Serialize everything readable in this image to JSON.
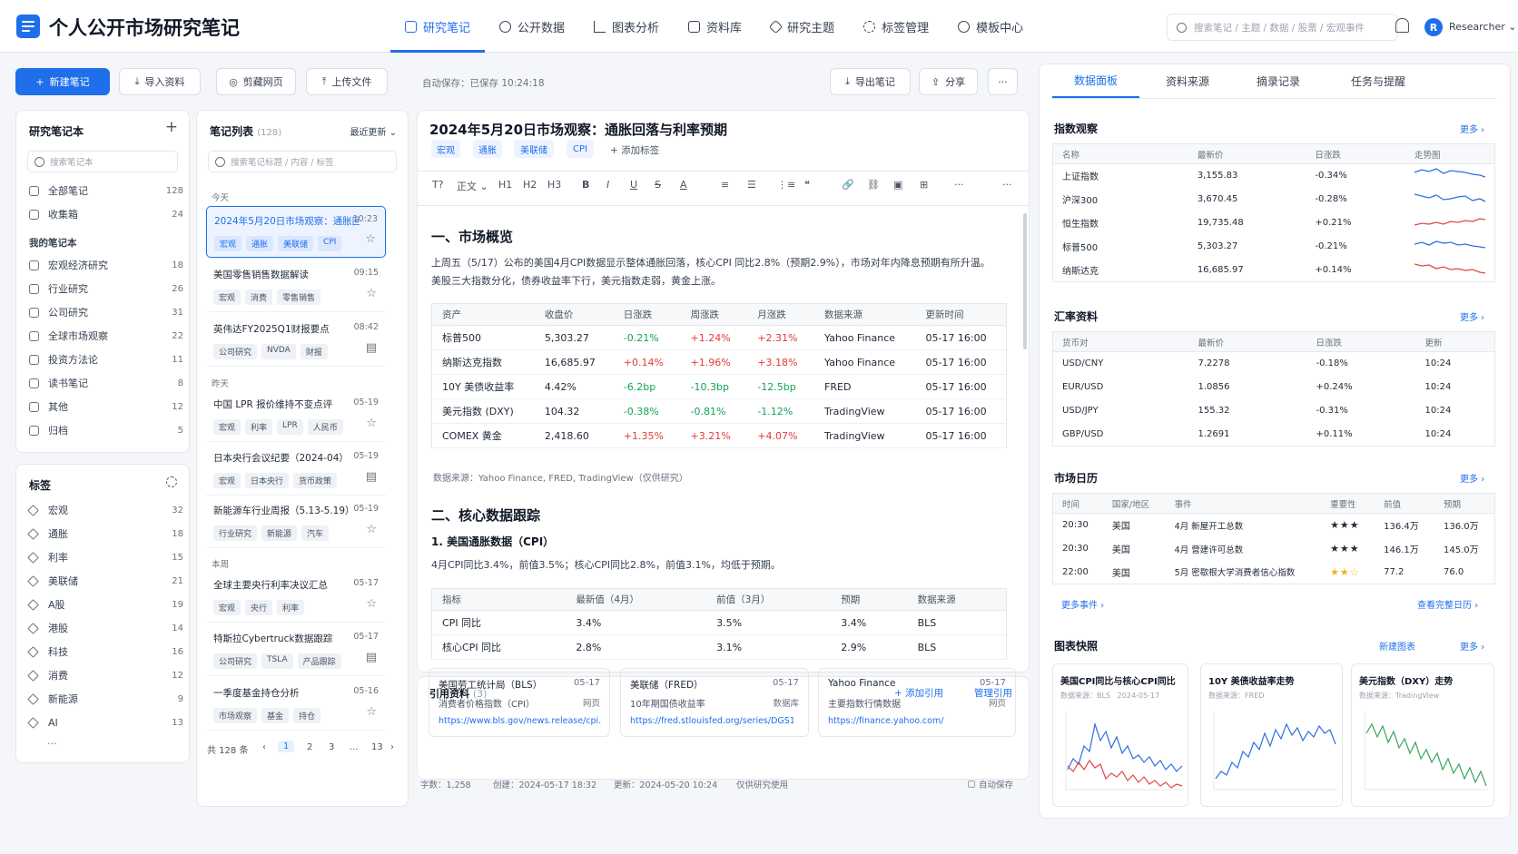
{
  "app": {
    "title": "个人公开市场研究笔记",
    "search_placeholder": "搜索笔记 / 主题 / 数据 / 股票 / 宏观事件",
    "user": "Researcher",
    "avatar_letter": "R",
    "accent": "#1f6feb"
  },
  "nav": [
    {
      "label": "研究笔记",
      "active": true
    },
    {
      "label": "公开数据"
    },
    {
      "label": "图表分析"
    },
    {
      "label": "资料库"
    },
    {
      "label": "研究主题"
    },
    {
      "label": "标签管理"
    },
    {
      "label": "模板中心"
    }
  ],
  "toolbar": {
    "new_note": "新建笔记",
    "import": "导入资料",
    "clip": "剪藏网页",
    "upload": "上传文件",
    "autosave": "自动保存：已保存 10:24:18",
    "export": "导出笔记",
    "share": "分享"
  },
  "notebooks": {
    "title": "研究笔记本",
    "search_placeholder": "搜索笔记本",
    "top": [
      {
        "label": "全部笔记",
        "count": "128"
      },
      {
        "label": "收集箱",
        "count": "24"
      }
    ],
    "group": "我的笔记本",
    "items": [
      {
        "label": "宏观经济研究",
        "count": "18"
      },
      {
        "label": "行业研究",
        "count": "26"
      },
      {
        "label": "公司研究",
        "count": "31"
      },
      {
        "label": "全球市场观察",
        "count": "22"
      },
      {
        "label": "投资方法论",
        "count": "11"
      },
      {
        "label": "读书笔记",
        "count": "8"
      },
      {
        "label": "其他",
        "count": "12"
      },
      {
        "label": "归档",
        "count": "5"
      }
    ]
  },
  "tags": {
    "title": "标签",
    "items": [
      {
        "label": "宏观",
        "count": "32"
      },
      {
        "label": "通胀",
        "count": "18"
      },
      {
        "label": "利率",
        "count": "15"
      },
      {
        "label": "美联储",
        "count": "21"
      },
      {
        "label": "A股",
        "count": "19"
      },
      {
        "label": "港股",
        "count": "14"
      },
      {
        "label": "科技",
        "count": "16"
      },
      {
        "label": "消费",
        "count": "12"
      },
      {
        "label": "新能源",
        "count": "9"
      },
      {
        "label": "AI",
        "count": "13"
      }
    ],
    "more": "..."
  },
  "notes": {
    "title": "笔记列表",
    "count": "(128)",
    "sort": "最近更新",
    "search_placeholder": "搜索笔记标题 / 内容 / 标签",
    "sections": {
      "today": "今天",
      "yesterday": "昨天",
      "week": "本周"
    },
    "items": [
      {
        "title": "2024年5月20日市场观察：通胀回落与利率预期",
        "time": "10:23",
        "tags": [
          "宏观",
          "通胀",
          "美联储",
          "CPI"
        ],
        "icon": "☆"
      },
      {
        "title": "美国零售销售数据解读",
        "time": "09:15",
        "tags": [
          "宏观",
          "消费",
          "零售销售"
        ],
        "icon": "☆"
      },
      {
        "title": "英伟达FY2025Q1财报要点",
        "time": "08:42",
        "tags": [
          "公司研究",
          "NVDA",
          "财报"
        ],
        "icon": "▤"
      },
      {
        "title": "中国 LPR 报价维持不变点评",
        "time": "05-19",
        "tags": [
          "宏观",
          "利率",
          "LPR",
          "人民币"
        ],
        "icon": "☆"
      },
      {
        "title": "日本央行会议纪要（2024-04）",
        "time": "05-19",
        "tags": [
          "宏观",
          "日本央行",
          "货币政策"
        ],
        "icon": "▤"
      },
      {
        "title": "新能源车行业周报（5.13-5.19）",
        "time": "05-19",
        "tags": [
          "行业研究",
          "新能源",
          "汽车"
        ],
        "icon": "☆"
      },
      {
        "title": "全球主要央行利率决议汇总",
        "time": "05-17",
        "tags": [
          "宏观",
          "央行",
          "利率"
        ],
        "icon": "☆"
      },
      {
        "title": "特斯拉Cybertruck数据跟踪",
        "time": "05-17",
        "tags": [
          "公司研究",
          "TSLA",
          "产品跟踪"
        ],
        "icon": "▤"
      },
      {
        "title": "一季度基金持仓分析",
        "time": "05-16",
        "tags": [
          "市场观察",
          "基金",
          "持仓"
        ],
        "icon": "☆"
      }
    ],
    "pagination": {
      "total": "共 128 条",
      "prev": "‹",
      "pages": [
        "1",
        "2",
        "3",
        "...",
        "13"
      ],
      "next": "›"
    }
  },
  "editor": {
    "title": "2024年5月20日市场观察：通胀回落与利率预期",
    "tags": [
      "宏观",
      "通胀",
      "美联储",
      "CPI"
    ],
    "add_tag": "+ 添加标签",
    "tools": [
      "T?",
      "正文 ⌄",
      "H1",
      "H2",
      "H3",
      "B",
      "I",
      "U",
      "S",
      "A",
      "≡",
      "☰",
      "⋮≡",
      "❝",
      "🔗",
      "⛓",
      "▣",
      "⊞",
      "···",
      "···"
    ],
    "sec1": "一、市场概览",
    "p1": "上周五（5/17）公布的美国4月CPI数据显示整体通胀回落，核心CPI 同比2.8%（预期2.9%），市场对年内降息预期有所升温。",
    "p2": "美股三大指数分化，债券收益率下行，美元指数走弱，黄金上涨。",
    "t1": {
      "headers": [
        "资产",
        "收盘价",
        "日涨跌",
        "周涨跌",
        "月涨跌",
        "数据来源",
        "更新时间"
      ],
      "rows": [
        [
          "标普500",
          "5,303.27",
          "-0.21%",
          "+1.24%",
          "+2.31%",
          "Yahoo Finance",
          "05-17 16:00"
        ],
        [
          "纳斯达克指数",
          "16,685.97",
          "+0.14%",
          "+1.96%",
          "+3.18%",
          "Yahoo Finance",
          "05-17 16:00"
        ],
        [
          "10Y 美债收益率",
          "4.42%",
          "-6.2bp",
          "-10.3bp",
          "-12.5bp",
          "FRED",
          "05-17 16:00"
        ],
        [
          "美元指数 (DXY)",
          "104.32",
          "-0.38%",
          "-0.81%",
          "-1.12%",
          "TradingView",
          "05-17 16:00"
        ],
        [
          "COMEX 黄金",
          "2,418.60",
          "+1.35%",
          "+3.21%",
          "+4.07%",
          "TradingView",
          "05-17 16:00"
        ]
      ]
    },
    "source": "数据来源：Yahoo Finance, FRED, TradingView（仅供研究）",
    "sec2": "二、核心数据跟踪",
    "sub1": "1. 美国通胀数据（CPI）",
    "p3": "4月CPI同比3.4%，前值3.5%；核心CPI同比2.8%，前值3.1%，均低于预期。",
    "t2": {
      "headers": [
        "指标",
        "最新值（4月）",
        "前值（3月）",
        "预期",
        "数据来源"
      ],
      "rows": [
        [
          "CPI 同比",
          "3.4%",
          "3.5%",
          "3.4%",
          "BLS"
        ],
        [
          "核心CPI 同比",
          "2.8%",
          "3.1%",
          "2.9%",
          "BLS"
        ]
      ]
    },
    "refs": {
      "title": "引用资料",
      "count": "(3)",
      "add": "+ 添加引用",
      "manage": "管理引用",
      "items": [
        {
          "name": "美国劳工统计局（BLS）",
          "date": "05-17",
          "desc": "消费者价格指数（CPI）",
          "type": "网页",
          "url": "https://www.bls.gov/news.release/cpi.htm"
        },
        {
          "name": "美联储（FRED）",
          "date": "05-17",
          "desc": "10年期国债收益率",
          "type": "数据库",
          "url": "https://fred.stlouisfed.org/series/DGS10"
        },
        {
          "name": "Yahoo Finance",
          "date": "05-17",
          "desc": "主要指数行情数据",
          "type": "网页",
          "url": "https://finance.yahoo.com/"
        }
      ]
    },
    "footer": {
      "words": "字数：1,258",
      "created": "创建：2024-05-17 18:32",
      "updated": "更新：2024-05-20 10:24",
      "scope": "仅供研究使用",
      "autosave": "自动保存"
    }
  },
  "right": {
    "tabs": [
      {
        "label": "数据面板",
        "active": true
      },
      {
        "label": "资料来源"
      },
      {
        "label": "摘录记录"
      },
      {
        "label": "任务与提醒"
      }
    ],
    "more": "更多 ›",
    "index": {
      "title": "指数观察",
      "headers": [
        "名称",
        "最新价",
        "日涨跌",
        "走势图"
      ],
      "rows": [
        {
          "name": "上证指数",
          "price": "3,155.83",
          "chg": "-0.34%",
          "dir": "dn"
        },
        {
          "name": "沪深300",
          "price": "3,670.45",
          "chg": "-0.28%",
          "dir": "dn"
        },
        {
          "name": "恒生指数",
          "price": "19,735.48",
          "chg": "+0.21%",
          "dir": "up"
        },
        {
          "name": "标普500",
          "price": "5,303.27",
          "chg": "-0.21%",
          "dir": "dn"
        },
        {
          "name": "纳斯达克",
          "price": "16,685.97",
          "chg": "+0.14%",
          "dir": "up"
        }
      ]
    },
    "fx": {
      "title": "汇率资料",
      "headers": [
        "货币对",
        "最新价",
        "日涨跌",
        "更新"
      ],
      "rows": [
        [
          "USD/CNY",
          "7.2278",
          "-0.18%",
          "10:24"
        ],
        [
          "EUR/USD",
          "1.0856",
          "+0.24%",
          "10:24"
        ],
        [
          "USD/JPY",
          "155.32",
          "-0.31%",
          "10:24"
        ],
        [
          "GBP/USD",
          "1.2691",
          "+0.11%",
          "10:24"
        ]
      ]
    },
    "cal": {
      "title": "市场日历",
      "headers": [
        "时间",
        "国家/地区",
        "事件",
        "重要性",
        "前值",
        "预期"
      ],
      "rows": [
        [
          "20:30",
          "美国",
          "4月 新屋开工总数",
          "★★★",
          "136.4万",
          "136.0万"
        ],
        [
          "20:30",
          "美国",
          "4月 营建许可总数",
          "★★★",
          "146.1万",
          "145.0万"
        ],
        [
          "22:00",
          "美国",
          "5月 密歇根大学消费者信心指数",
          "★★☆",
          "77.2",
          "76.0"
        ]
      ],
      "more_events": "更多事件 ›",
      "full": "查看完整日历 ›"
    },
    "charts": {
      "title": "图表快照",
      "new": "新建图表",
      "items": [
        {
          "title": "美国CPI同比与核心CPI同比",
          "source": "数据来源：BLS",
          "date": "2024-05-17"
        },
        {
          "title": "10Y 美债收益率走势",
          "source": "数据来源：FRED"
        },
        {
          "title": "美元指数（DXY）走势",
          "source": "数据来源：TradingView"
        }
      ]
    }
  },
  "colors": {
    "up": "#e23b3b",
    "down": "#11a35a",
    "blue_line": "#2f6fe0",
    "red_line": "#e0473f",
    "green_line": "#3aa55c"
  }
}
